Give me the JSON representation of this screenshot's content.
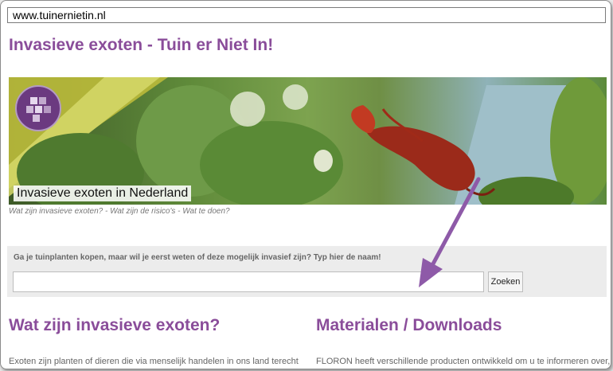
{
  "browser": {
    "url": "www.tuinernietin.nl"
  },
  "site": {
    "title": "Invasieve exoten - Tuin er Niet In!"
  },
  "banner": {
    "caption": "Invasieve exoten in Nederland",
    "tagline": "Wat zijn invasieve exoten? - Wat zijn de risico's - Wat te doen?"
  },
  "search": {
    "prompt": "Ga je tuinplanten kopen, maar wil je eerst weten of deze mogelijk invasief zijn? Typ hier de naam!",
    "value": "",
    "button_label": "Zoeken"
  },
  "sections": {
    "left": {
      "heading": "Wat zijn invasieve exoten?",
      "text": "Exoten zijn planten of dieren die via menselijk handelen in ons land terecht"
    },
    "right": {
      "heading": "Materialen / Downloads",
      "text": "FLORON heeft verschillende producten ontwikkeld om u te informeren over, en"
    }
  },
  "colors": {
    "accent": "#8a4d9a",
    "arrow": "#8e5aa8"
  }
}
